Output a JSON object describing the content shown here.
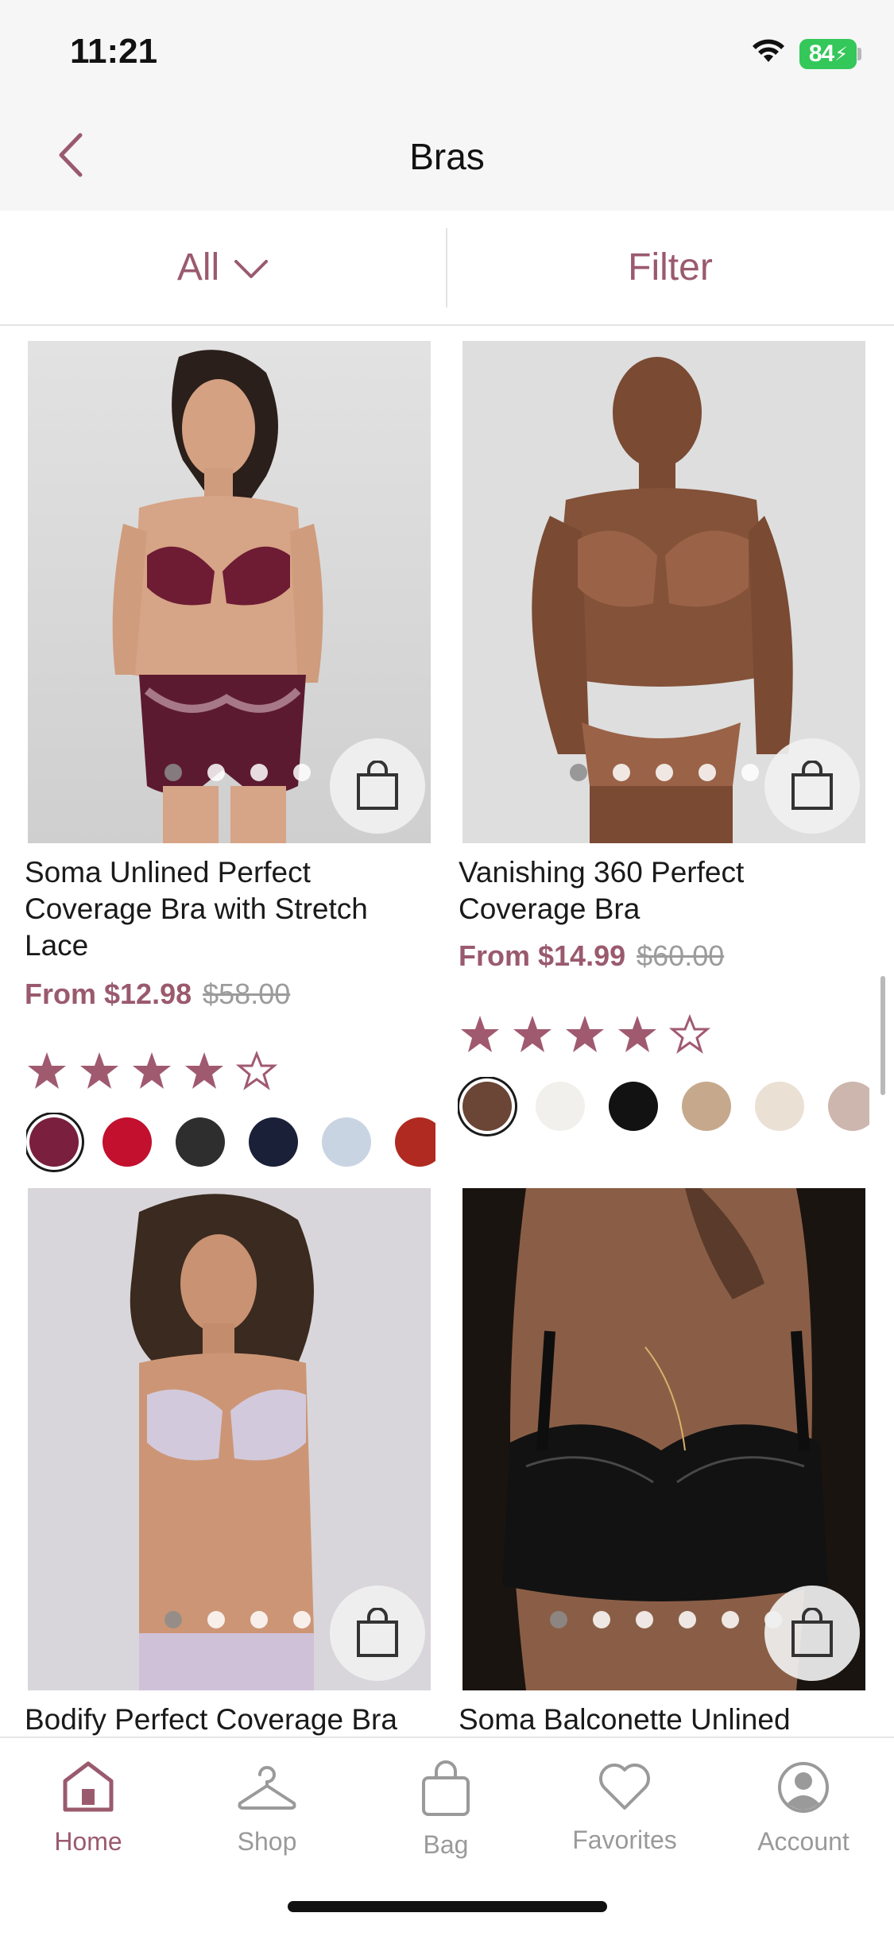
{
  "status": {
    "time": "11:21",
    "battery": "84"
  },
  "nav": {
    "title": "Bras"
  },
  "filters": {
    "all_label": "All",
    "filter_label": "Filter"
  },
  "colors": {
    "accent": "#9a5a6e",
    "star": "#a05a70",
    "muted": "#9a9a9a"
  },
  "products": [
    {
      "name": "Soma Unlined Perfect Coverage Bra with Stretch Lace",
      "price": "From $12.98",
      "was": "$58.00",
      "rating": 4,
      "image_dots": 4,
      "active_dot": 0,
      "swatches": [
        "#7a1f3d",
        "#c2102e",
        "#2e2e2e",
        "#1a2038",
        "#c8d4e2",
        "#b02a22"
      ]
    },
    {
      "name": "Vanishing 360 Perfect Coverage Bra",
      "price": "From $14.99",
      "was": "$60.00",
      "rating": 4,
      "image_dots": 5,
      "active_dot": 0,
      "swatches": [
        "#6b4535",
        "#f1f0ec",
        "#121212",
        "#c6a98c",
        "#ebe0d4",
        "#cdb6ae"
      ]
    },
    {
      "name": "Bodify Perfect Coverage Bra",
      "image_dots": 4,
      "active_dot": 0
    },
    {
      "name": "Soma Balconette Unlined Bra",
      "image_dots": 6,
      "active_dot": 0
    }
  ],
  "tabs": [
    {
      "label": "Home",
      "icon": "home-icon",
      "active": true
    },
    {
      "label": "Shop",
      "icon": "hanger-icon",
      "active": false
    },
    {
      "label": "Bag",
      "icon": "bag-icon",
      "active": false
    },
    {
      "label": "Favorites",
      "icon": "heart-icon",
      "active": false
    },
    {
      "label": "Account",
      "icon": "account-icon",
      "active": false
    }
  ]
}
